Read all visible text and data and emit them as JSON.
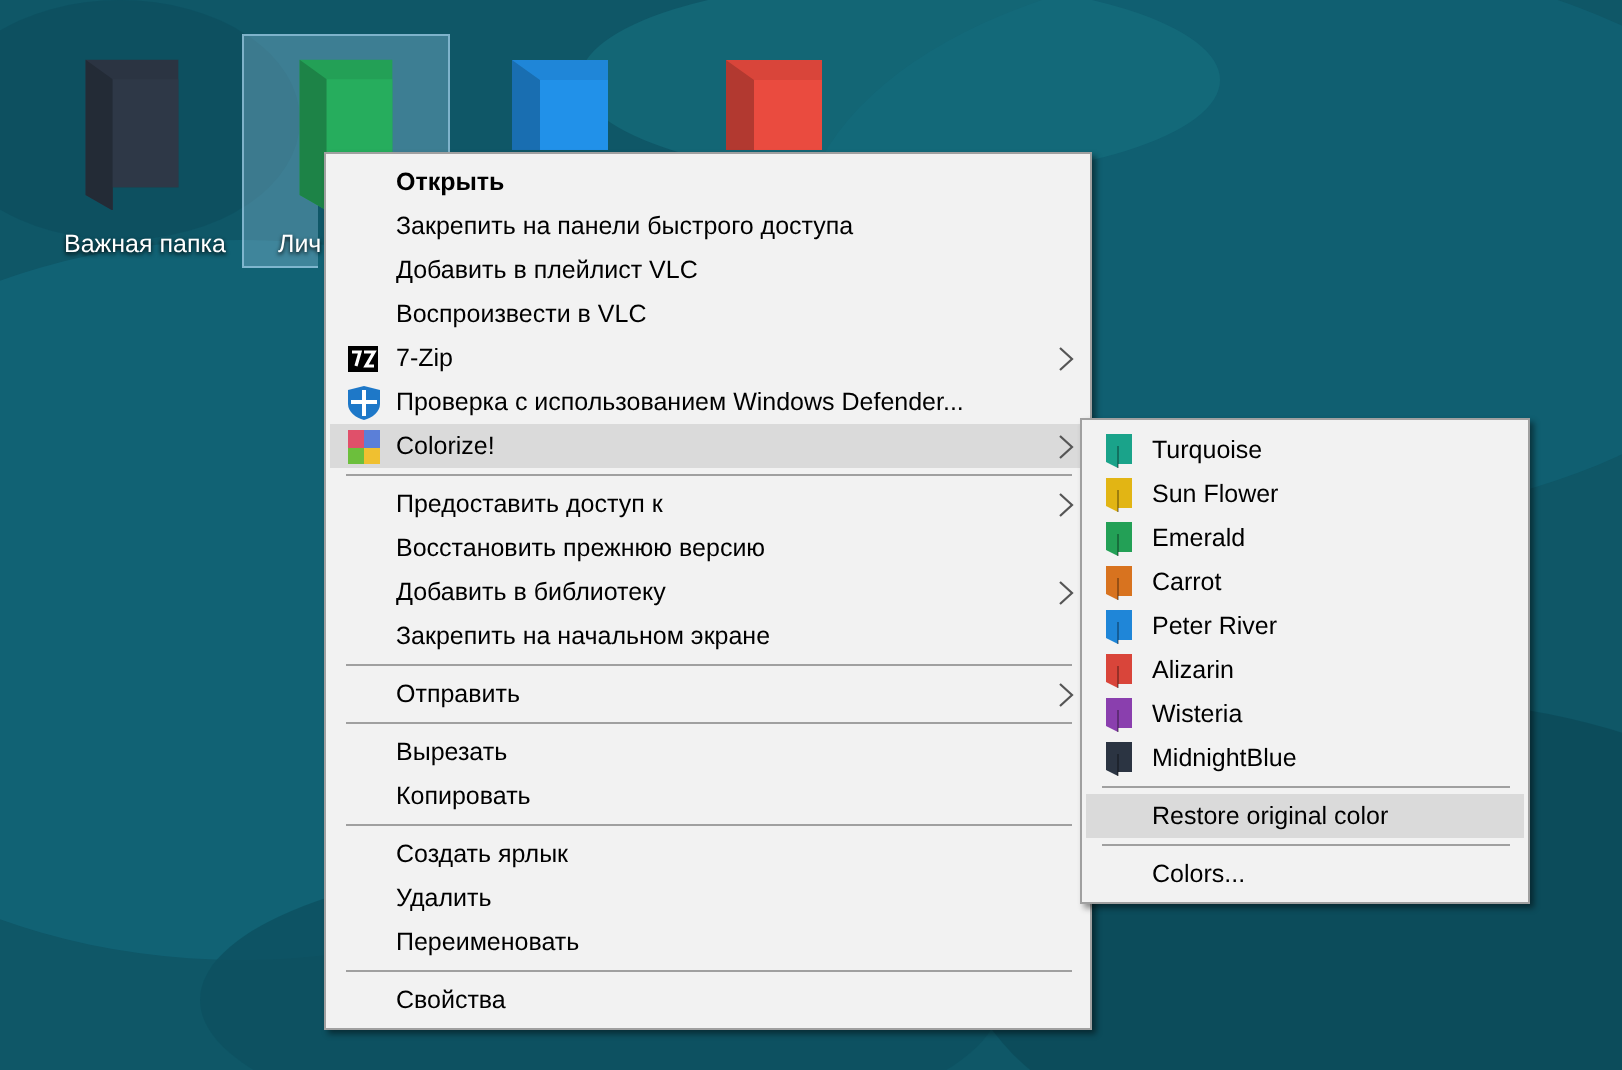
{
  "desktop": {
    "icons": [
      {
        "label": "Важная папка",
        "color": "#2b3442",
        "selected": false
      },
      {
        "label": "Лич",
        "color": "#23a056",
        "selected": true
      },
      {
        "color": "#1f86d8",
        "selected": false
      },
      {
        "color": "#d9453a",
        "selected": false
      }
    ]
  },
  "context_menu": {
    "items": [
      {
        "kind": "item",
        "label": "Открыть",
        "bold": true,
        "selected": false
      },
      {
        "kind": "item",
        "label": "Закрепить на панели быстрого доступа",
        "selected": false
      },
      {
        "kind": "item",
        "label": "Добавить в плейлист VLC",
        "selected": false
      },
      {
        "kind": "item",
        "label": "Воспроизвести в VLC",
        "selected": false
      },
      {
        "kind": "item",
        "label": "7-Zip",
        "submenu": true,
        "selected": false
      },
      {
        "kind": "item",
        "label": "Проверка с использованием Windows Defender...",
        "selected": false
      },
      {
        "kind": "item",
        "label": "Colorize!",
        "submenu": true,
        "selected": true
      },
      {
        "kind": "separator"
      },
      {
        "kind": "item",
        "label": "Предоставить доступ к",
        "submenu": true,
        "selected": false
      },
      {
        "kind": "item",
        "label": "Восстановить прежнюю версию",
        "selected": false
      },
      {
        "kind": "item",
        "label": "Добавить в библиотеку",
        "submenu": true,
        "selected": false
      },
      {
        "kind": "item",
        "label": "Закрепить на начальном экране",
        "selected": false
      },
      {
        "kind": "separator"
      },
      {
        "kind": "item",
        "label": "Отправить",
        "submenu": true,
        "selected": false
      },
      {
        "kind": "separator"
      },
      {
        "kind": "item",
        "label": "Вырезать",
        "selected": false
      },
      {
        "kind": "item",
        "label": "Копировать",
        "selected": false
      },
      {
        "kind": "separator"
      },
      {
        "kind": "item",
        "label": "Создать ярлык",
        "selected": false
      },
      {
        "kind": "item",
        "label": "Удалить",
        "selected": false
      },
      {
        "kind": "item",
        "label": "Переименовать",
        "selected": false
      },
      {
        "kind": "separator"
      },
      {
        "kind": "item",
        "label": "Свойства",
        "selected": false
      }
    ]
  },
  "colorize_submenu": {
    "items": [
      {
        "kind": "color",
        "label": "Turquoise",
        "color": "#1aa38a",
        "selected": false
      },
      {
        "kind": "color",
        "label": "Sun Flower",
        "color": "#e2b514",
        "selected": false
      },
      {
        "kind": "color",
        "label": "Emerald",
        "color": "#23a056",
        "selected": false
      },
      {
        "kind": "color",
        "label": "Carrot",
        "color": "#d8731f",
        "selected": false
      },
      {
        "kind": "color",
        "label": "Peter River",
        "color": "#1f86d8",
        "selected": false
      },
      {
        "kind": "color",
        "label": "Alizarin",
        "color": "#d9453a",
        "selected": false
      },
      {
        "kind": "color",
        "label": "Wisteria",
        "color": "#8a3fae",
        "selected": false
      },
      {
        "kind": "color",
        "label": "MidnightBlue",
        "color": "#2b3442",
        "selected": false
      },
      {
        "kind": "separator"
      },
      {
        "kind": "item",
        "label": "Restore original color",
        "selected": true
      },
      {
        "kind": "separator"
      },
      {
        "kind": "item",
        "label": "Colors...",
        "selected": false
      }
    ]
  }
}
